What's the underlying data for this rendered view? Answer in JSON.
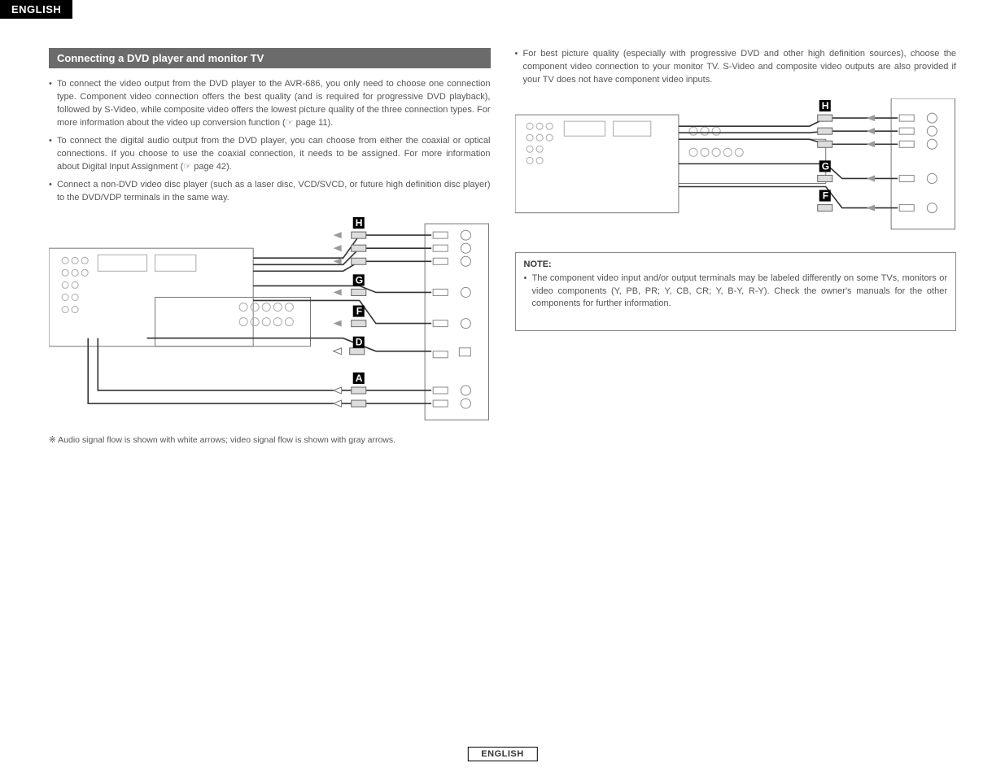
{
  "header_tab": "ENGLISH",
  "section_title": "Connecting a DVD player and monitor TV",
  "left_bullets": [
    "To connect the video output from the DVD player to the AVR-686, you only need to choose one connection type. Component video connection offers the best quality (and is required for progressive DVD playback), followed by S-Video, while composite video offers the lowest picture quality of the three connection types. For more information about the video up conversion function (☞ page 11).",
    "To connect the digital audio output from the DVD player, you can choose from either the coaxial or optical connections. If you choose to use the coaxial connection, it needs to be assigned. For more information about Digital Input Assignment (☞ page 42).",
    "Connect a non-DVD video disc player (such as a laser disc, VCD/SVCD, or future high definition disc player) to the DVD/VDP terminals in the same way."
  ],
  "right_bullets": [
    "For best picture quality (especially with progressive DVD and other high definition sources), choose the component video connection to your monitor TV. S-Video and composite video outputs are also provided if your TV does not have component video inputs."
  ],
  "diagram_left": {
    "labels": [
      "H",
      "G",
      "F",
      "D",
      "A"
    ]
  },
  "diagram_right": {
    "labels": [
      "H",
      "G",
      "F"
    ]
  },
  "caption": "※ Audio signal flow is shown with white arrows; video signal flow is shown with gray arrows.",
  "note_title": "NOTE:",
  "note_bullets": [
    "The component video input and/or output terminals may be labeled differently on some TVs, monitors or video components (Y, PB, PR; Y, CB, CR; Y, B-Y, R-Y). Check the owner's manuals for the other components for further information."
  ],
  "footer_label": "ENGLISH"
}
